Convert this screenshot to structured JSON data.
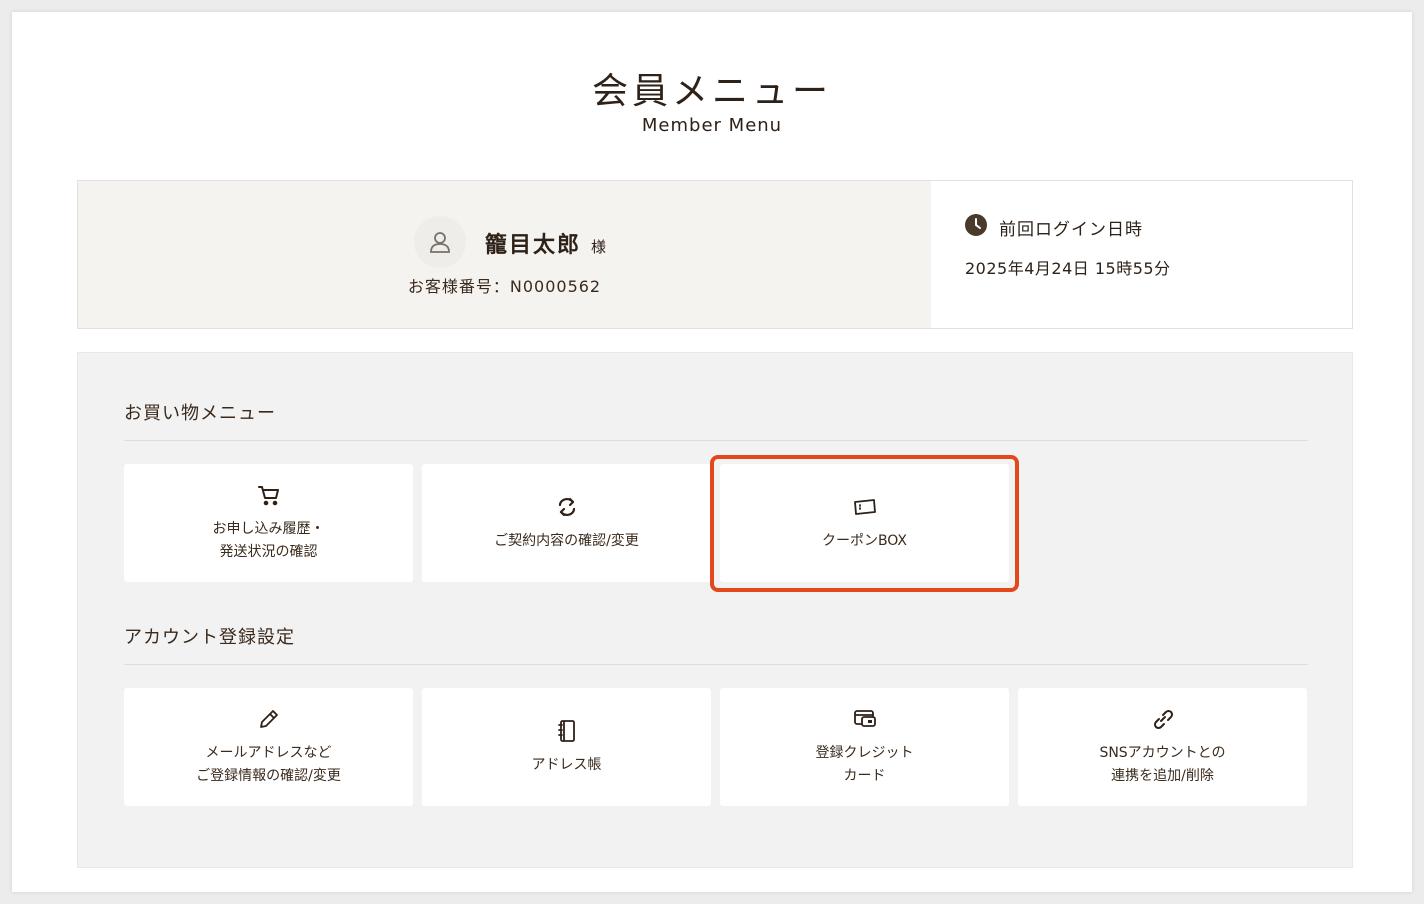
{
  "header": {
    "title": "会員メニュー",
    "subtitle": "Member Menu"
  },
  "member": {
    "name": "籠目太郎",
    "suffix": "様",
    "customer_number": "お客様番号：N0000562"
  },
  "last_login": {
    "label": "前回ログイン日時",
    "value": "2025年4月24日 15時55分"
  },
  "shopping_menu": {
    "title": "お買い物メニュー",
    "items": [
      {
        "label": "お申し込み履歴・\n発送状況の確認",
        "icon": "cart-icon"
      },
      {
        "label": "ご契約内容の確認/変更",
        "icon": "refresh-icon"
      },
      {
        "label": "クーポンBOX",
        "icon": "coupon-icon"
      }
    ]
  },
  "account_menu": {
    "title": "アカウント登録設定",
    "items": [
      {
        "label": "メールアドレスなど\nご登録情報の確認/変更",
        "icon": "pencil-icon"
      },
      {
        "label": "アドレス帳",
        "icon": "address-book-icon"
      },
      {
        "label": "登録クレジット\nカード",
        "icon": "credit-card-icon"
      },
      {
        "label": "SNSアカウントとの\n連携を追加/削除",
        "icon": "link-icon"
      }
    ]
  },
  "colors": {
    "text": "#3a2a1c",
    "highlight": "#e4471c",
    "panel": "#f2f2f2",
    "member_bg": "#f5f3f0"
  }
}
